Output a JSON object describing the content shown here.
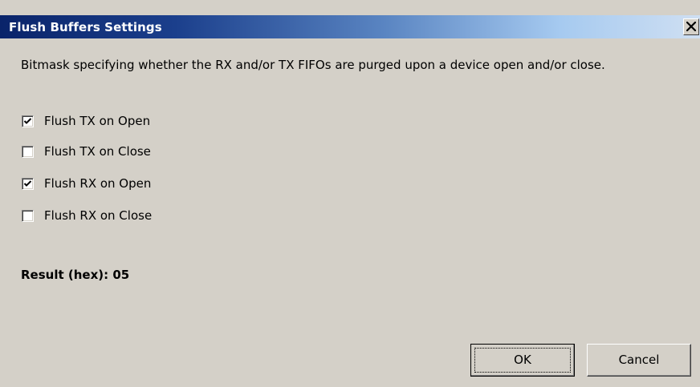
{
  "window": {
    "title": "Flush Buffers Settings",
    "close_icon": "close-icon",
    "colors": {
      "titlebar_start": "#0a246a",
      "titlebar_end": "#cfdff2",
      "face": "#d4d0c8"
    }
  },
  "description": "Bitmask specifying whether the RX and/or TX FIFOs are purged upon a device open and/or close.",
  "options": [
    {
      "label": "Flush TX on Open",
      "checked": true
    },
    {
      "label": "Flush TX on Close",
      "checked": false
    },
    {
      "label": "Flush RX on Open",
      "checked": true
    },
    {
      "label": "Flush RX on Close",
      "checked": false
    }
  ],
  "result": {
    "text": "Result (hex): 05"
  },
  "buttons": {
    "ok_label": "OK",
    "cancel_label": "Cancel"
  }
}
